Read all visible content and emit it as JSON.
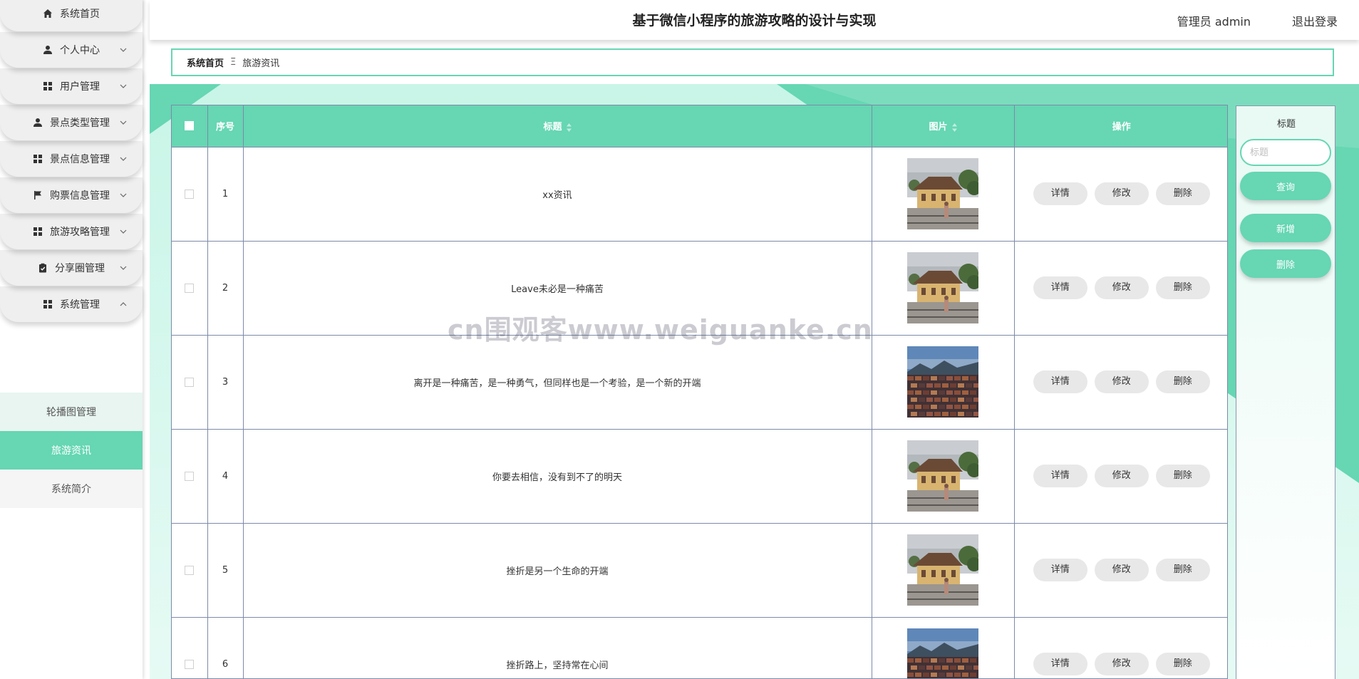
{
  "sidebar": {
    "items": [
      {
        "label": "系统首页",
        "icon": "home-icon",
        "chevron": "none"
      },
      {
        "label": "个人中心",
        "icon": "user-icon",
        "chevron": "down"
      },
      {
        "label": "用户管理",
        "icon": "grid-icon",
        "chevron": "down"
      },
      {
        "label": "景点类型管理",
        "icon": "user-icon",
        "chevron": "down"
      },
      {
        "label": "景点信息管理",
        "icon": "grid-icon",
        "chevron": "down"
      },
      {
        "label": "购票信息管理",
        "icon": "flag-icon",
        "chevron": "down"
      },
      {
        "label": "旅游攻略管理",
        "icon": "grid-icon",
        "chevron": "down"
      },
      {
        "label": "分享圈管理",
        "icon": "clipboard-icon",
        "chevron": "down"
      },
      {
        "label": "系统管理",
        "icon": "grid-icon",
        "chevron": "up"
      }
    ],
    "sub_items": [
      {
        "label": "轮播图管理",
        "state": "hover"
      },
      {
        "label": "旅游资讯",
        "state": "active"
      },
      {
        "label": "系统简介",
        "state": "normal"
      }
    ]
  },
  "header": {
    "title": "基于微信小程序的旅游攻略的设计与实现",
    "admin": "管理员 admin",
    "logout": "退出登录"
  },
  "breadcrumb": {
    "home": "系统首页",
    "separator": "Ξ",
    "current": "旅游资讯"
  },
  "table": {
    "columns": {
      "index": "序号",
      "title": "标题",
      "image": "图片",
      "actions": "操作"
    },
    "actions": {
      "detail": "详情",
      "edit": "修改",
      "delete": "删除"
    },
    "rows": [
      {
        "index": "1",
        "title": "xx资讯",
        "image": "station-photo"
      },
      {
        "index": "2",
        "title": "Leave未必是一种痛苦",
        "image": "station-photo"
      },
      {
        "index": "3",
        "title": "离开是一种痛苦，是一种勇气，但同样也是一个考验，是一个新的开端",
        "image": "town-photo"
      },
      {
        "index": "4",
        "title": "你要去相信，没有到不了的明天",
        "image": "station-photo"
      },
      {
        "index": "5",
        "title": "挫折是另一个生命的开端",
        "image": "station-photo"
      },
      {
        "index": "6",
        "title": "挫折路上，坚持常在心间",
        "image": "town-photo"
      }
    ]
  },
  "search": {
    "label": "标题",
    "placeholder": "标题",
    "query_button": "查询",
    "add_button": "新增",
    "delete_button": "删除"
  },
  "watermark": "cn围观客www.weiguanke.cn",
  "colors": {
    "accent": "#66d6b3",
    "button_gray": "#e8e8e8",
    "border": "#7d8aa8"
  }
}
